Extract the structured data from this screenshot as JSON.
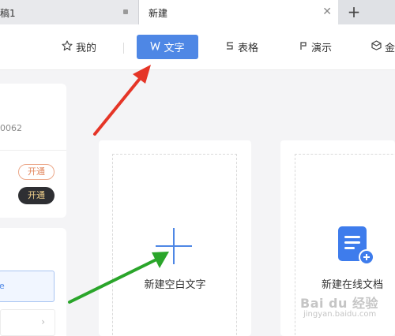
{
  "tabs": [
    {
      "label": "稿1"
    },
    {
      "label": "新建"
    }
  ],
  "tab_close": "✕",
  "new_tab": "+",
  "toolbar": {
    "mine": "我的",
    "text": "文字",
    "sheet": "表格",
    "present": "演示",
    "more": "金"
  },
  "left_panel": {
    "number": "0062",
    "open_outline": "开通",
    "open_solid": "开通",
    "input_text": "e",
    "chevron": "›"
  },
  "cards": {
    "blank_text": "新建空白文字",
    "online_doc": "新建在线文档"
  },
  "watermark": {
    "line1": "Bai du 经验",
    "line2": "jingyan.baidu.com"
  },
  "colors": {
    "accent": "#4e87e5",
    "red_arrow": "#e53527",
    "green_arrow": "#2aa52a"
  }
}
